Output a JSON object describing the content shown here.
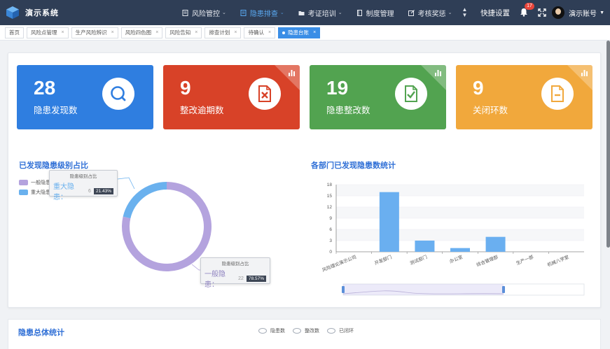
{
  "app": {
    "title": "演示系统"
  },
  "nav": [
    {
      "label": "风险管控",
      "has_caret": true,
      "active": false,
      "icon": "doc-icon"
    },
    {
      "label": "隐患排查",
      "has_caret": true,
      "active": true,
      "icon": "doc-icon"
    },
    {
      "label": "考证培训",
      "has_caret": true,
      "active": false,
      "icon": "folder-icon"
    },
    {
      "label": "制度管理",
      "has_caret": false,
      "active": false,
      "icon": "book-icon"
    },
    {
      "label": "考核奖惩",
      "has_caret": true,
      "active": false,
      "icon": "edit-icon"
    }
  ],
  "header_right": {
    "quick_settings": "快捷设置",
    "notification_count": "17",
    "user_name": "演示账号"
  },
  "tabs": [
    {
      "label": "首页",
      "closable": false,
      "active": false
    },
    {
      "label": "风险点管理",
      "closable": true,
      "active": false
    },
    {
      "label": "生产风险辨识",
      "closable": true,
      "active": false
    },
    {
      "label": "风险四色图",
      "closable": true,
      "active": false
    },
    {
      "label": "风险告知",
      "closable": true,
      "active": false
    },
    {
      "label": "排查计划",
      "closable": true,
      "active": false
    },
    {
      "label": "待确认",
      "closable": true,
      "active": false
    },
    {
      "label": "隐患台账",
      "closable": true,
      "active": true
    }
  ],
  "cards": [
    {
      "value": "28",
      "label": "隐患发现数",
      "color": "#2f7ee0",
      "icon": "search-icon"
    },
    {
      "value": "9",
      "label": "整改逾期数",
      "color": "#d84228",
      "icon": "x-doc-icon"
    },
    {
      "value": "19",
      "label": "隐患整改数",
      "color": "#52a350",
      "icon": "check-doc-icon"
    },
    {
      "value": "9",
      "label": "关闭环数",
      "color": "#f1a83c",
      "icon": "minus-doc-icon"
    }
  ],
  "level_chart": {
    "title": "已发现隐患级别占比",
    "legend": [
      "一般隐患",
      "重大隐患"
    ],
    "colors": [
      "#b4a3de",
      "#6ab1ee"
    ],
    "tooltip_major": {
      "title": "隐患级别占比",
      "name": "重大隐患：",
      "value": "6",
      "percent": "21.43%"
    },
    "tooltip_general": {
      "title": "隐患级别占比",
      "name": "一般隐患：",
      "value": "22",
      "percent": "78.57%"
    }
  },
  "chart_data": [
    {
      "type": "pie",
      "title": "已发现隐患级别占比",
      "labels": [
        "一般隐患",
        "重大隐患"
      ],
      "values": [
        22,
        6
      ],
      "percents": [
        78.57,
        21.43
      ]
    },
    {
      "type": "bar",
      "title": "各部门已发现隐患数统计",
      "categories": [
        "风险理论演示公司",
        "开发部门",
        "测试部门",
        "办公室",
        "综合管理部",
        "生产一部",
        "机械八学堂"
      ],
      "values": [
        0,
        16,
        3,
        1,
        4,
        0,
        0
      ],
      "ylim": [
        0,
        18
      ],
      "yticks": [
        0,
        3,
        6,
        9,
        12,
        15,
        18
      ],
      "color": "#6aaff0",
      "grid": true
    }
  ],
  "dept_chart": {
    "title": "各部门已发现隐患数统计"
  },
  "bottom": {
    "title": "隐患总体统计",
    "legend": [
      "隐患数",
      "整改数",
      "已闭环"
    ]
  }
}
